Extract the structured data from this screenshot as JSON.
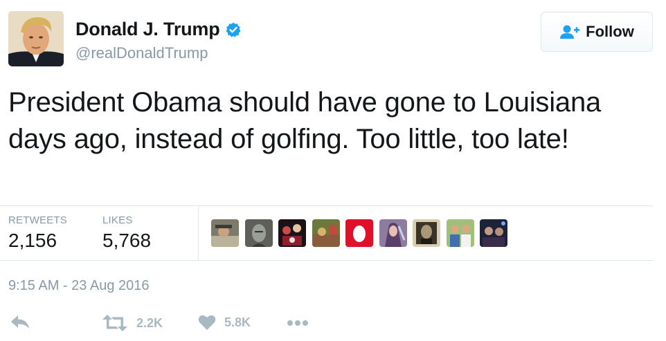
{
  "header": {
    "display_name": "Donald J. Trump",
    "handle": "@realDonaldTrump",
    "follow_label": "Follow"
  },
  "tweet": {
    "text": "President Obama should have gone to Louisiana days ago, instead of golfing. Too little, too late!",
    "timestamp": "9:15 AM - 23 Aug 2016"
  },
  "stats": {
    "retweets_label": "RETWEETS",
    "retweets_value": "2,156",
    "likes_label": "LIKES",
    "likes_value": "5,768"
  },
  "actions": {
    "retweet_count": "2.2K",
    "like_count": "5.8K"
  },
  "icons": {
    "verified": "verified-badge-icon",
    "follow": "add-user-icon",
    "reply": "reply-icon",
    "retweet": "retweet-icon",
    "like": "heart-icon",
    "more": "more-dots-icon"
  },
  "colors": {
    "accent": "#1da1f2",
    "muted": "#8899a6",
    "action_gray": "#aab8c2",
    "text": "#14171a",
    "divider": "#e1e8ed"
  }
}
